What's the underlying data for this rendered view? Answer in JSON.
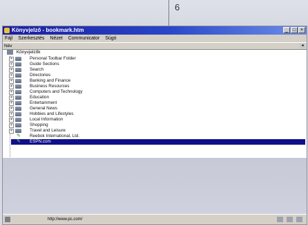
{
  "page": {
    "page_number": "6"
  },
  "window": {
    "title": "Könyvjelző - bookmark.htm",
    "minimize_glyph": "_",
    "maximize_glyph": "□",
    "close_glyph": "×"
  },
  "menu": [
    "Fájl",
    "Szerkesztés",
    "Nézet",
    "Communicator",
    "Súgó"
  ],
  "header": {
    "column": "Név",
    "scroll_glyph": "◂"
  },
  "tree": {
    "root": "Könyvjelzők",
    "expand_glyph": "+",
    "items": [
      {
        "label": "Personal Toolbar Folder"
      },
      {
        "label": "Guide Sections"
      },
      {
        "label": "Search"
      },
      {
        "label": "Directories"
      },
      {
        "label": "Banking and Finance"
      },
      {
        "label": "Business Resources"
      },
      {
        "label": "Computers and Technology"
      },
      {
        "label": "Education"
      },
      {
        "label": "Entertainment"
      },
      {
        "label": "General News"
      },
      {
        "label": "Hobbies and Lifestyles"
      },
      {
        "label": "Local Information"
      },
      {
        "label": "Shopping"
      },
      {
        "label": "Travel and Leisure"
      }
    ],
    "bookmarks": [
      {
        "label": "Reebok International, Ltd."
      },
      {
        "label": "ESPN.com"
      }
    ]
  },
  "status": {
    "url": "http://www.pc.com/"
  },
  "icons": {
    "app": "netscape-icon",
    "folder": "folder-icon",
    "bookmark": "bookmark-icon"
  }
}
